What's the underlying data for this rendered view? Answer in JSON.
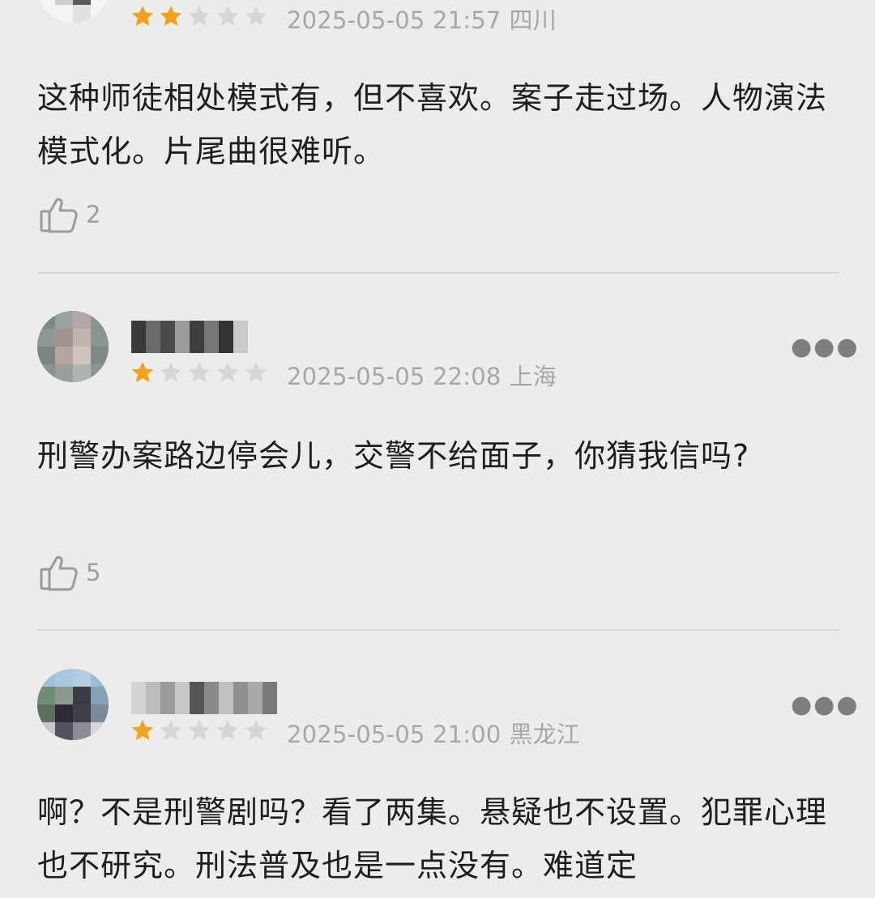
{
  "reviews": [
    {
      "rating": 2,
      "date": "2025-05-05 21:57",
      "region": "四川",
      "content": "这种师徒相处模式有，但不喜欢。案子走过场。人物演法模式化。片尾曲很难听。",
      "likes": "2"
    },
    {
      "rating": 1,
      "date": "2025-05-05 22:08",
      "region": "上海",
      "content": "刑警办案路边停会儿，交警不给面子，你猜我信吗?",
      "likes": "5"
    },
    {
      "rating": 1,
      "date": "2025-05-05 21:00",
      "region": "黑龙江",
      "content": "啊？不是刑警剧吗？看了两集。悬疑也不设置。犯罪心理也不研究。刑法普及也是一点没有。难道定",
      "likes": ""
    }
  ],
  "icons": {
    "star": "star-icon",
    "like": "thumbs-up-icon",
    "more": "more-dots-icon"
  },
  "colors": {
    "star_filled": "#f2a11e",
    "star_empty": "#d6d6d6",
    "meta_text": "#a7a7a7",
    "divider": "#d6d6d4"
  }
}
